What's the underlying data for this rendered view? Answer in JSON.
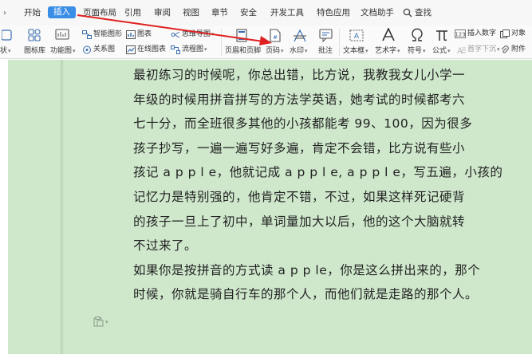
{
  "menu": {
    "items": [
      "开始",
      "插入",
      "页面布局",
      "引用",
      "审阅",
      "视图",
      "章节",
      "安全",
      "开发工具",
      "特色应用",
      "文档助手"
    ],
    "active": "插入",
    "search_label": "查找"
  },
  "ribbon": {
    "shape_label": "状",
    "icon_lib_label": "图标库",
    "func_chart_label": "功能图",
    "smart_shape_label": "智能图形",
    "chart_label": "图表",
    "mind_map_label": "思维导图",
    "relation_label": "关系图",
    "online_chart_label": "在线图表",
    "flowchart_label": "流程图",
    "header_footer_label": "页眉和页脚",
    "page_num_label": "页码",
    "watermark_label": "水印",
    "comment_label": "批注",
    "textbox_label": "文本框",
    "wordart_label": "艺术字",
    "symbol_label": "符号",
    "formula_label": "公式",
    "insert_number_label": "插入数字",
    "object_label": "对象",
    "drop_cap_label": "首字下沉",
    "attachment_label": "附件"
  },
  "document": {
    "lines": [
      "最初练习的时候呢，你总出错，比方说，我教我女儿小学一",
      "年级的时候用拼音拼写的方法学英语，她考试的时候都考六",
      "七十分，而全班很多其他的小孩都能考 99、100，因为很多",
      "孩子抄写，一遍一遍写好多遍，肯定不会错，比方说有些小",
      "孩记 a p p l e，他就记成 a p p l e, a p p l e，写五遍，小孩的",
      "记忆力是特别强的，他肯定不错，不过，如果这样死记硬背",
      "的孩子一旦上了初中，单词量加大以后，他的这个大脑就转",
      "不过来了。",
      "如果你是按拼音的方式读 a p p le，你是这么拼出来的，那个",
      "时候，你就是骑自行车的那个人，而他们就是走路的那个人。"
    ]
  },
  "colors": {
    "active_tab": "#3a8ee6",
    "doc_background": "#cfe8cc",
    "annotation_arrow": "#e02020"
  }
}
